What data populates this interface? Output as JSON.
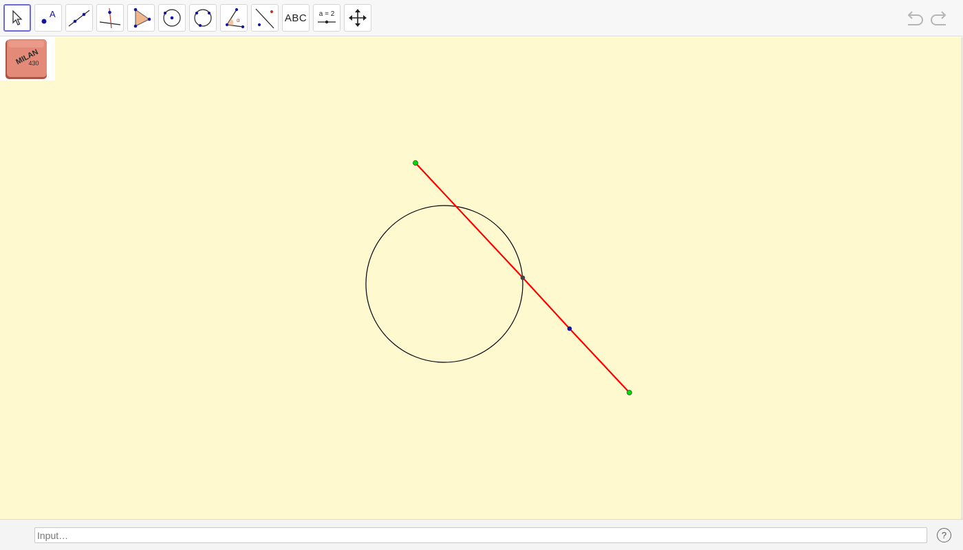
{
  "toolbar": {
    "tools": [
      {
        "name": "move",
        "icon": "pointer-arrow-icon",
        "selected": true
      },
      {
        "name": "point",
        "icon": "point-icon",
        "label": "A"
      },
      {
        "name": "line",
        "icon": "line-through-two-points-icon"
      },
      {
        "name": "perpendicular-line",
        "icon": "perpendicular-line-icon"
      },
      {
        "name": "polygon",
        "icon": "polygon-icon"
      },
      {
        "name": "circle-center-point",
        "icon": "circle-center-icon"
      },
      {
        "name": "circle-three-points",
        "icon": "circle-three-points-icon"
      },
      {
        "name": "angle",
        "icon": "angle-icon",
        "label": "α"
      },
      {
        "name": "reflect",
        "icon": "reflect-about-line-icon"
      },
      {
        "name": "text",
        "icon": "text-icon",
        "label": "ABC"
      },
      {
        "name": "slider",
        "icon": "slider-icon",
        "label": "a = 2"
      },
      {
        "name": "move-graphics-view",
        "icon": "move-cross-arrows-icon"
      }
    ],
    "undo_icon": "undo-icon",
    "redo_icon": "redo-icon"
  },
  "canvas": {
    "background": "#fff9cf",
    "image_label_line1": "MILAN",
    "image_label_line2": "430",
    "colors": {
      "segment": "#ff0000",
      "circle": "#000000",
      "endpoint": "#00dd00",
      "point_blue": "#1515a0",
      "point_dark": "#444444"
    }
  },
  "input": {
    "placeholder": "Input…"
  },
  "help_label": "?"
}
